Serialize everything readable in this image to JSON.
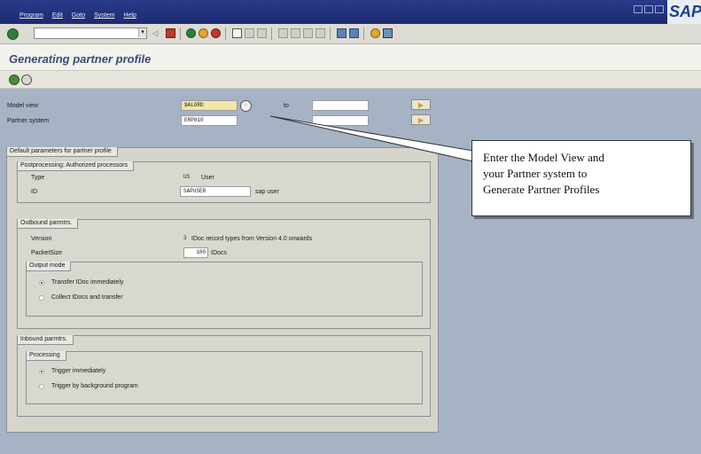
{
  "menu": {
    "items": [
      "Program",
      "Edit",
      "Goto",
      "System",
      "Help"
    ],
    "logo": "SAP"
  },
  "title": "Generating partner profile",
  "selection": {
    "model_view_label": "Model view",
    "model_view_value": "$ALORD",
    "to_label": "to",
    "partner_system_label": "Partner system",
    "partner_system_value": "ERP010"
  },
  "defaults": {
    "title": "Default parameters for partner profile",
    "postprocessing": {
      "title": "Postprocessing: Authorized processors",
      "type_label": "Type",
      "type_value": "US",
      "type_text": "User",
      "id_label": "ID",
      "id_value": "SAPUSER",
      "id_text": "sap user"
    },
    "outbound": {
      "title": "Outbound parmtrs.",
      "version_label": "Version",
      "version_value": "3",
      "version_text": "IDoc record types from Version 4.0 onwards",
      "packet_label": "PacketSize",
      "packet_value": "100",
      "packet_text": "IDocs",
      "output_mode": {
        "title": "Output mode",
        "options": [
          "Transfer IDoc immediately",
          "Collect IDocs and transfer"
        ],
        "selected": 0
      }
    },
    "inbound": {
      "title": "Inbound parmtrs.",
      "processing": {
        "title": "Processing",
        "options": [
          "Trigger immediately",
          "Trigger by background program"
        ],
        "selected": 0
      }
    }
  },
  "callout": {
    "lines": [
      "Enter the Model View and",
      "your Partner system to",
      "Generate Partner Profiles"
    ]
  },
  "colors": {
    "menubar": "#1d2b70",
    "background": "#a6b3c4",
    "title_text": "#3a4c7a",
    "required_field": "#f2e6a8"
  }
}
